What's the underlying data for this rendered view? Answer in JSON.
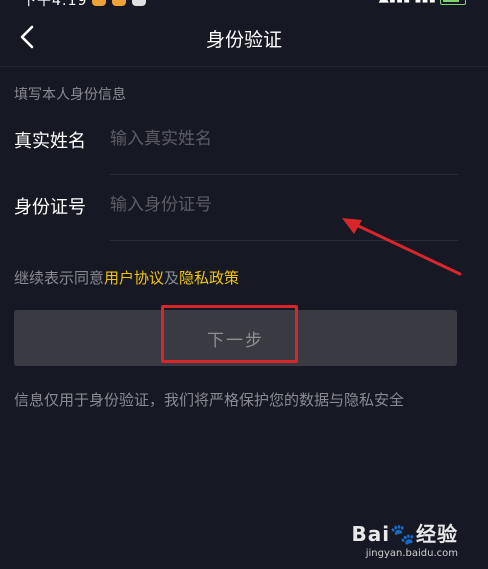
{
  "status": {
    "time": "下午4:19",
    "battery_color": "#7fd36a"
  },
  "nav": {
    "title": "身份验证",
    "back_icon": "chevron-left-icon"
  },
  "form": {
    "section_hint": "填写本人身份信息",
    "name_label": "真实姓名",
    "name_placeholder": "输入真实姓名",
    "name_value": "",
    "id_label": "身份证号",
    "id_placeholder": "输入身份证号",
    "id_value": ""
  },
  "agreement": {
    "prefix": "继续表示同意",
    "user_agreement": "用户协议",
    "conjunction": "及",
    "privacy_policy": "隐私政策"
  },
  "next_button": {
    "label": "下一步"
  },
  "privacy_note": "信息仅用于身份验证，我们将严格保护您的数据与隐私安全",
  "watermark": {
    "logo": "Bai🐾经验",
    "url": "jingyan.baidu.com"
  },
  "colors": {
    "background": "#161823",
    "link": "#f2c40d",
    "button": "#3a3b42",
    "annotation": "#d9262b"
  }
}
